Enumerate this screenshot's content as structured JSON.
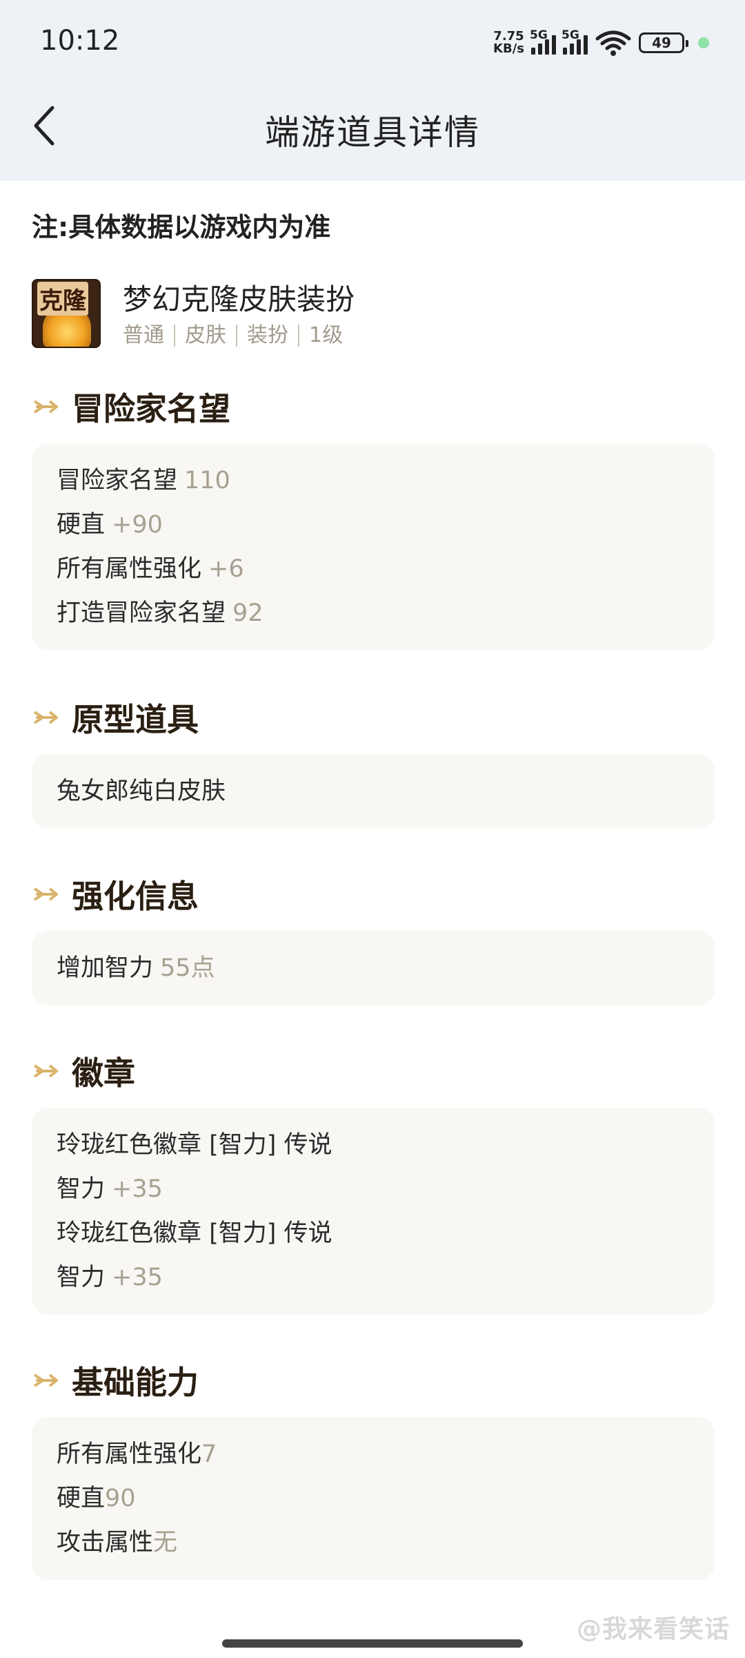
{
  "status_bar": {
    "time": "10:12",
    "net_speed_top": "7.75",
    "net_speed_bottom": "KB/s",
    "sim1": "5G",
    "sim2": "5G",
    "battery": "49"
  },
  "header": {
    "title": "端游道具详情"
  },
  "note": "注:具体数据以游戏内为准",
  "item": {
    "icon_text": "克隆",
    "name": "梦幻克隆皮肤装扮",
    "tags": [
      "普通",
      "皮肤",
      "装扮",
      "1级"
    ]
  },
  "sections": [
    {
      "title": "冒险家名望",
      "lines": [
        {
          "label": "冒险家名望",
          "value": "110"
        },
        {
          "label": "硬直",
          "value": "+90"
        },
        {
          "label": "所有属性强化",
          "value": "+6"
        },
        {
          "label": "打造冒险家名望",
          "value": "92"
        }
      ]
    },
    {
      "title": "原型道具",
      "lines": [
        {
          "label": "兔女郎纯白皮肤",
          "value": ""
        }
      ]
    },
    {
      "title": "强化信息",
      "lines": [
        {
          "label": "增加智力",
          "value": "55点"
        }
      ]
    },
    {
      "title": "徽章",
      "lines": [
        {
          "label": "玲珑红色徽章 [智力] 传说",
          "value": ""
        },
        {
          "label": "智力",
          "value": "+35"
        },
        {
          "label": "玲珑红色徽章 [智力] 传说",
          "value": ""
        },
        {
          "label": "智力",
          "value": "+35"
        }
      ]
    },
    {
      "title": "基础能力",
      "lines": [
        {
          "label": "所有属性强化",
          "value": "7"
        },
        {
          "label": "硬直",
          "value": "90"
        },
        {
          "label": "攻击属性",
          "value": "无"
        }
      ]
    }
  ],
  "watermark": "@我来看笑话",
  "colors": {
    "accent_arrow": "#d9b36a",
    "value_text": "#a8a090",
    "card_bg": "#f8f7f4",
    "header_bg": "#eef1f6"
  }
}
